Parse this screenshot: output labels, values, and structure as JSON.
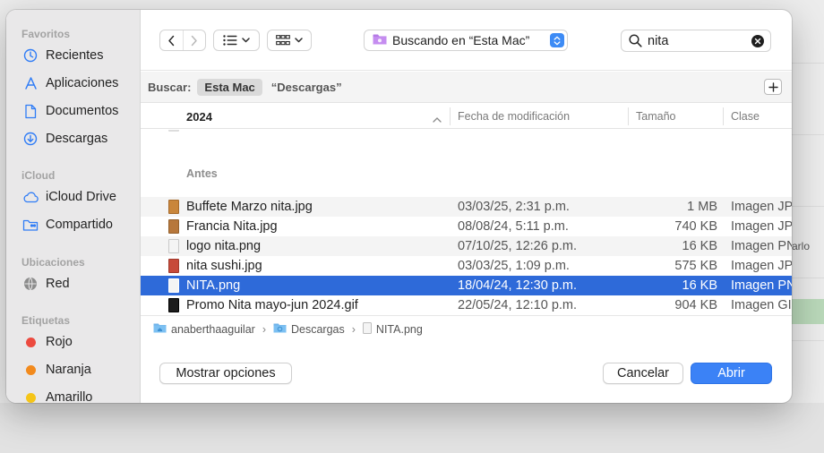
{
  "background": {
    "partial_text": "arlo"
  },
  "sidebar": {
    "sections": [
      {
        "title": "Favoritos",
        "items": [
          {
            "label": "Recientes",
            "icon": "clock-icon"
          },
          {
            "label": "Aplicaciones",
            "icon": "applications-icon"
          },
          {
            "label": "Documentos",
            "icon": "document-icon"
          },
          {
            "label": "Descargas",
            "icon": "download-icon"
          }
        ]
      },
      {
        "title": "iCloud",
        "items": [
          {
            "label": "iCloud Drive",
            "icon": "cloud-icon"
          },
          {
            "label": "Compartido",
            "icon": "shared-folder-icon"
          }
        ]
      },
      {
        "title": "Ubicaciones",
        "items": [
          {
            "label": "Red",
            "icon": "network-icon"
          }
        ]
      },
      {
        "title": "Etiquetas",
        "items": [
          {
            "label": "Rojo",
            "color": "#ec4a3f"
          },
          {
            "label": "Naranja",
            "color": "#f28a1d"
          },
          {
            "label": "Amarillo",
            "color": "#f5c518"
          }
        ]
      }
    ]
  },
  "toolbar": {
    "location": "Buscando en “Esta Mac”",
    "search_value": "nita"
  },
  "scope": {
    "label": "Buscar:",
    "selected": "Esta Mac",
    "other": "“Descargas”"
  },
  "columns": {
    "name": "2024",
    "date": "Fecha de modificación",
    "size": "Tamaño",
    "kind": "Clase"
  },
  "files": {
    "group_label": "Antes",
    "rows": [
      {
        "name": "Buffete Marzo nita.jpg",
        "date": "03/03/25, 2:31 p.m.",
        "size": "1 MB",
        "kind": "Imagen JP",
        "icon": "#c9863b"
      },
      {
        "name": "Francia Nita.jpg",
        "date": "08/08/24, 5:11 p.m.",
        "size": "740 KB",
        "kind": "Imagen JP",
        "icon": "#b7773b"
      },
      {
        "name": "logo nita.png",
        "date": "07/10/25, 12:26 p.m.",
        "size": "16 KB",
        "kind": "Imagen PN",
        "icon": "#e3e3e3"
      },
      {
        "name": "nita sushi.jpg",
        "date": "03/03/25, 1:09 p.m.",
        "size": "575 KB",
        "kind": "Imagen JP",
        "icon": "#c74a3a"
      },
      {
        "name": "NITA.png",
        "date": "18/04/24, 12:30 p.m.",
        "size": "16 KB",
        "kind": "Imagen PN",
        "icon": "#e3e3e3",
        "selected": true
      },
      {
        "name": "Promo Nita mayo-jun 2024.gif",
        "date": "22/05/24, 12:10 p.m.",
        "size": "904 KB",
        "kind": "Imagen GI",
        "icon": "#1d1d1d"
      }
    ]
  },
  "path": {
    "segments": [
      "anaberthaaguilar",
      "Descargas",
      "NITA.png"
    ]
  },
  "buttons": {
    "options": "Mostrar opciones",
    "cancel": "Cancelar",
    "open": "Abrir"
  },
  "colors": {
    "accent": "#3b82f6",
    "selection": "#2e6ad9"
  }
}
